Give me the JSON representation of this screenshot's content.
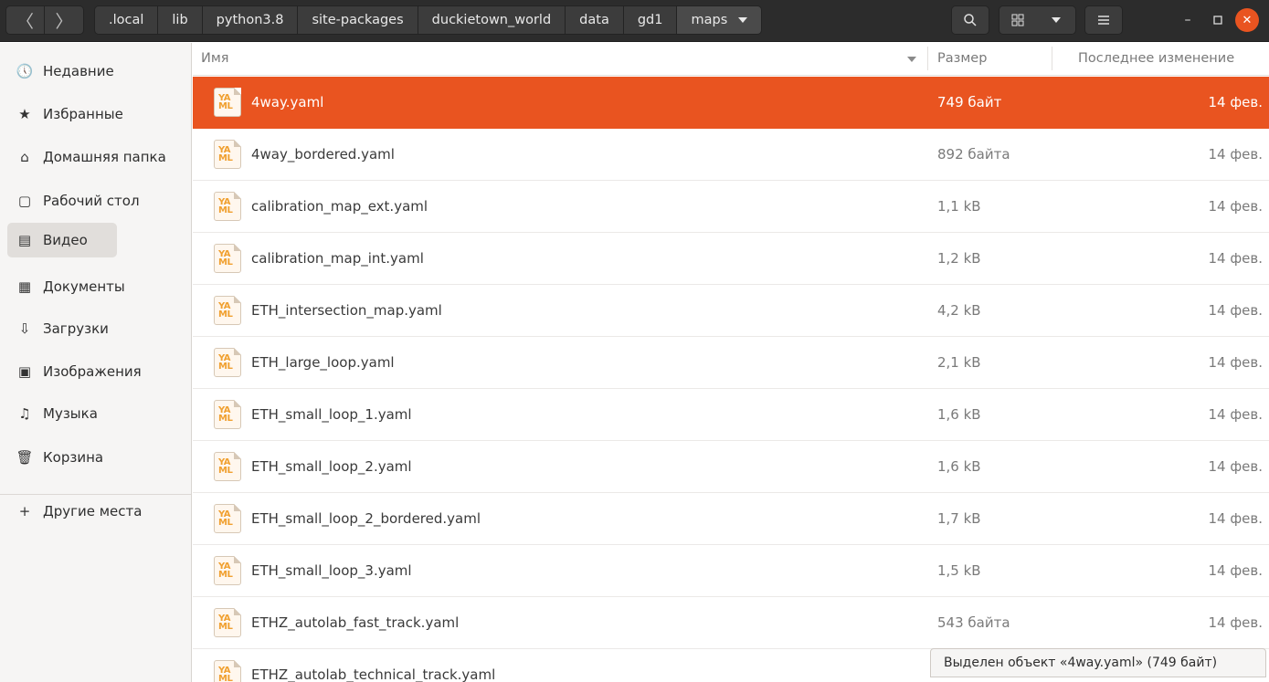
{
  "nav": {
    "back_icon": "chevron-left",
    "forward_icon": "chevron-right",
    "back_glyph": "〈",
    "forward_glyph": "〉"
  },
  "breadcrumbs": [
    ".local",
    "lib",
    "python3.8",
    "site-packages",
    "duckietown_world",
    "data",
    "gd1",
    "maps"
  ],
  "header_icons": {
    "search": "search-icon",
    "view": "grid-view-icon",
    "menu": "hamburger-menu-icon"
  },
  "colors": {
    "accent": "#e95420",
    "header_bg": "#2c2c2c",
    "sidebar_bg": "#f6f5f4"
  },
  "sidebar": {
    "items": [
      {
        "label": "Недавние",
        "icon": "clock-icon",
        "glyph": "🕔"
      },
      {
        "label": "Избранные",
        "icon": "star-icon",
        "glyph": "★"
      },
      {
        "label": "Домашняя папка",
        "icon": "home-icon",
        "glyph": "⌂"
      },
      {
        "label": "Рабочий стол",
        "icon": "desktop-icon",
        "glyph": "▢"
      },
      {
        "label": "Видео",
        "icon": "video-icon",
        "glyph": "▤"
      },
      {
        "label": "Документы",
        "icon": "document-icon",
        "glyph": "▦"
      },
      {
        "label": "Загрузки",
        "icon": "download-icon",
        "glyph": "⇩"
      },
      {
        "label": "Изображения",
        "icon": "image-icon",
        "glyph": "▣"
      },
      {
        "label": "Музыка",
        "icon": "music-icon",
        "glyph": "♫"
      },
      {
        "label": "Корзина",
        "icon": "trash-icon",
        "glyph": "🗑"
      }
    ],
    "other_places": {
      "label": "Другие места",
      "icon": "plus-icon",
      "glyph": "+"
    }
  },
  "columns": {
    "name": "Имя",
    "size": "Размер",
    "modified": "Последнее изменение"
  },
  "file_icon_text": "YA\nML",
  "files": [
    {
      "name": "4way.yaml",
      "size": "749 байт",
      "modified": "14 фев."
    },
    {
      "name": "4way_bordered.yaml",
      "size": "892 байта",
      "modified": "14 фев."
    },
    {
      "name": "calibration_map_ext.yaml",
      "size": "1,1 kB",
      "modified": "14 фев."
    },
    {
      "name": "calibration_map_int.yaml",
      "size": "1,2 kB",
      "modified": "14 фев."
    },
    {
      "name": "ETH_intersection_map.yaml",
      "size": "4,2 kB",
      "modified": "14 фев."
    },
    {
      "name": "ETH_large_loop.yaml",
      "size": "2,1 kB",
      "modified": "14 фев."
    },
    {
      "name": "ETH_small_loop_1.yaml",
      "size": "1,6 kB",
      "modified": "14 фев."
    },
    {
      "name": "ETH_small_loop_2.yaml",
      "size": "1,6 kB",
      "modified": "14 фев."
    },
    {
      "name": "ETH_small_loop_2_bordered.yaml",
      "size": "1,7 kB",
      "modified": "14 фев."
    },
    {
      "name": "ETH_small_loop_3.yaml",
      "size": "1,5 kB",
      "modified": "14 фев."
    },
    {
      "name": "ETHZ_autolab_fast_track.yaml",
      "size": "543 байта",
      "modified": "14 фев."
    },
    {
      "name": "ETHZ_autolab_technical_track.yaml",
      "size": "",
      "modified": ""
    }
  ],
  "selected_index": 0,
  "status_text": "Выделен объект «4way.yaml» (749 байт)"
}
